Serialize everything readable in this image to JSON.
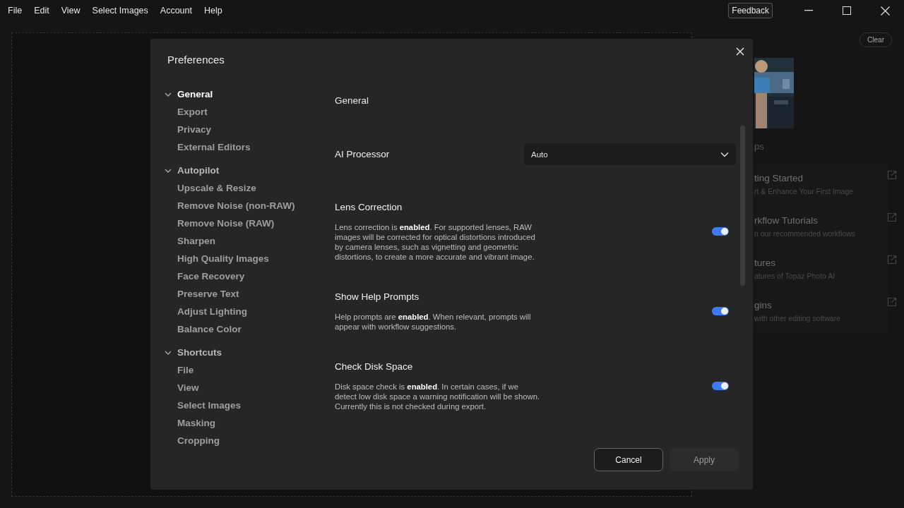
{
  "menu": [
    "File",
    "Edit",
    "View",
    "Select Images",
    "Account",
    "Help"
  ],
  "feedback_button": "Feedback",
  "right_panel": {
    "clear_button": "Clear",
    "section_label": "ps",
    "links": [
      {
        "title": "ting Started",
        "subtitle": "rt & Enhance Your First Image"
      },
      {
        "title": "rkflow Tutorials",
        "subtitle": "n our recommended workflows"
      },
      {
        "title": "tures",
        "subtitle": "atures of Topaz Photo AI"
      },
      {
        "title": "gins",
        "subtitle": "with other editing software"
      }
    ]
  },
  "dialog": {
    "title": "Preferences",
    "nav": [
      {
        "label": "General",
        "expanded": true,
        "selected": true,
        "children": [
          {
            "label": "Export",
            "selected": false
          },
          {
            "label": "Privacy",
            "selected": false
          },
          {
            "label": "External Editors",
            "selected": false
          }
        ]
      },
      {
        "label": "Autopilot",
        "expanded": true,
        "selected": false,
        "children": [
          {
            "label": "Upscale & Resize",
            "selected": false
          },
          {
            "label": "Remove Noise (non-RAW)",
            "selected": false
          },
          {
            "label": "Remove Noise (RAW)",
            "selected": false
          },
          {
            "label": "Sharpen",
            "selected": false
          },
          {
            "label": "High Quality Images",
            "selected": false
          },
          {
            "label": "Face Recovery",
            "selected": false
          },
          {
            "label": "Preserve Text",
            "selected": false
          },
          {
            "label": "Adjust Lighting",
            "selected": false
          },
          {
            "label": "Balance Color",
            "selected": false
          }
        ]
      },
      {
        "label": "Shortcuts",
        "expanded": true,
        "selected": false,
        "children": [
          {
            "label": "File",
            "selected": false
          },
          {
            "label": "View",
            "selected": false
          },
          {
            "label": "Select Images",
            "selected": false
          },
          {
            "label": "Masking",
            "selected": false
          },
          {
            "label": "Cropping",
            "selected": false
          }
        ]
      }
    ],
    "heading": "General",
    "ai_processor": {
      "label": "AI Processor",
      "value": "Auto"
    },
    "settings": [
      {
        "title": "Lens Correction",
        "description": "Lens correction is **enabled**. For supported lenses, RAW images will be corrected for optical distortions introduced by camera lenses, such as vignetting and geometric distortions, to create a more accurate and vibrant image.",
        "on": true
      },
      {
        "title": "Show Help Prompts",
        "description": "Help prompts are **enabled**. When relevant, prompts will appear with workflow suggestions.",
        "on": true
      },
      {
        "title": "Check Disk Space",
        "description": "Disk space check is **enabled**. In certain cases, if we detect low disk space a warning notification will be shown. Currently this is not checked during export.",
        "on": true
      }
    ],
    "buttons": [
      {
        "label": "Cancel",
        "disabled": false
      },
      {
        "label": "Apply",
        "disabled": true
      }
    ]
  }
}
